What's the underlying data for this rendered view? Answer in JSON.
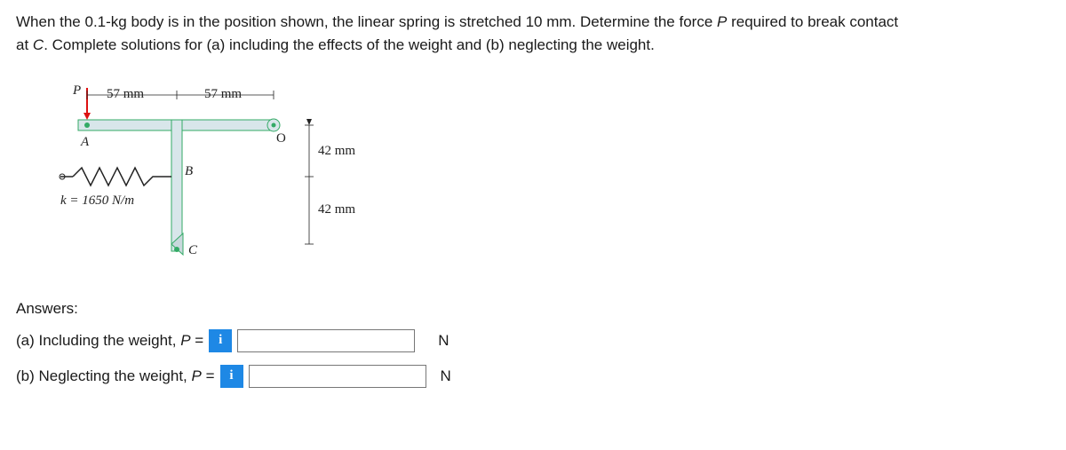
{
  "problem": {
    "line1_a": "When the 0.1-kg body is in the position shown, the linear spring is stretched 10 mm. Determine the force ",
    "line1_p": "P",
    "line1_b": " required to break contact",
    "line2_a": "at ",
    "line2_c": "C",
    "line2_b": ". Complete solutions for (a) including the effects of the weight and (b) neglecting the weight."
  },
  "diagram": {
    "force_label": "P",
    "dim_left": "57 mm",
    "dim_right": "57 mm",
    "dim_top_v": "42 mm",
    "dim_bot_v": "42 mm",
    "point_a": "A",
    "point_b": "B",
    "point_c": "C",
    "point_o": "O",
    "spring_k": "k = 1650 N/m"
  },
  "answers": {
    "title": "Answers:",
    "row_a_label_1": "(a) Including the weight, ",
    "row_a_label_p": "P",
    "row_a_label_2": " =",
    "row_b_label_1": "(b) Neglecting the weight, ",
    "row_b_label_p": "P",
    "row_b_label_2": " =",
    "info_icon": "i",
    "unit": "N",
    "value_a": "",
    "value_b": ""
  }
}
